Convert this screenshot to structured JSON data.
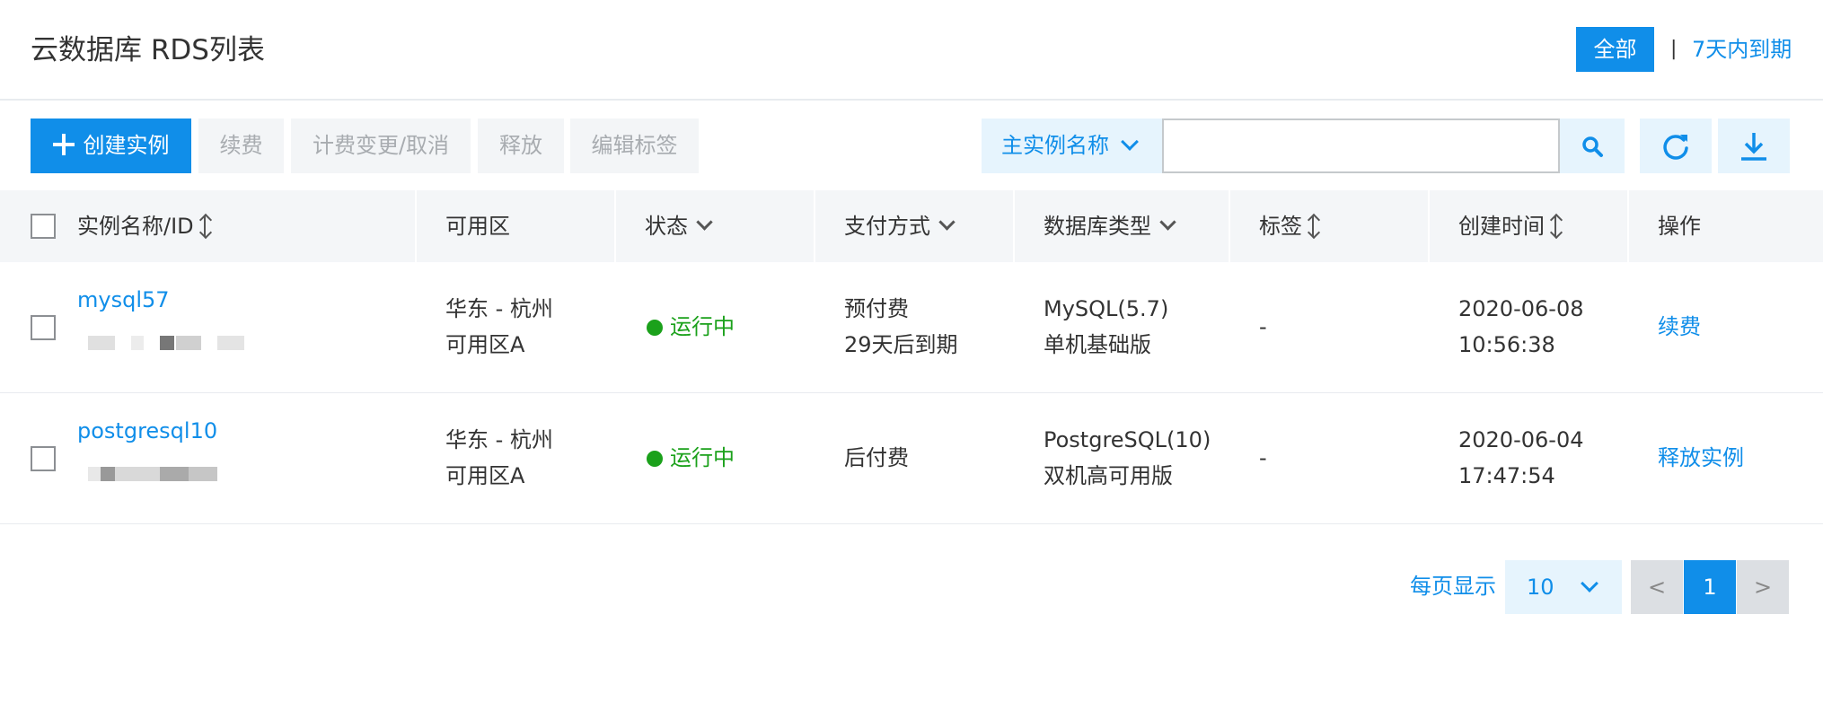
{
  "header": {
    "title": "云数据库 RDS列表",
    "filter_all": "全部",
    "separator": "|",
    "filter_7days": "7天内到期"
  },
  "toolbar": {
    "create_label": "创建实例",
    "renew_label": "续费",
    "billing_label": "计费变更/取消",
    "release_label": "释放",
    "edit_tags_label": "编辑标签",
    "search_field_label": "主实例名称",
    "search_value": ""
  },
  "table": {
    "columns": [
      "实例名称/ID",
      "可用区",
      "状态",
      "支付方式",
      "数据库类型",
      "标签",
      "创建时间",
      "操作"
    ],
    "rows": [
      {
        "name": "mysql57",
        "zone_line1": "华东 - 杭州",
        "zone_line2": "可用区A",
        "status": "运行中",
        "payment_line1": "预付费",
        "payment_line2": "29天后到期",
        "db_line1": "MySQL(5.7)",
        "db_line2": "单机基础版",
        "tags": "-",
        "created_date": "2020-06-08",
        "created_time": "10:56:38",
        "action": "续费"
      },
      {
        "name": "postgresql10",
        "zone_line1": "华东 - 杭州",
        "zone_line2": "可用区A",
        "status": "运行中",
        "payment_line1": "后付费",
        "payment_line2": "",
        "db_line1": "PostgreSQL(10)",
        "db_line2": "双机高可用版",
        "tags": "-",
        "created_date": "2020-06-04",
        "created_time": "17:47:54",
        "action": "释放实例"
      }
    ]
  },
  "pagination": {
    "label": "每页显示",
    "page_size": "10",
    "prev": "<",
    "current": "1",
    "next": ">"
  },
  "colors": {
    "accent": "#108ee9",
    "status_running": "#1ba11b",
    "header_bg": "#f4f6f8"
  }
}
